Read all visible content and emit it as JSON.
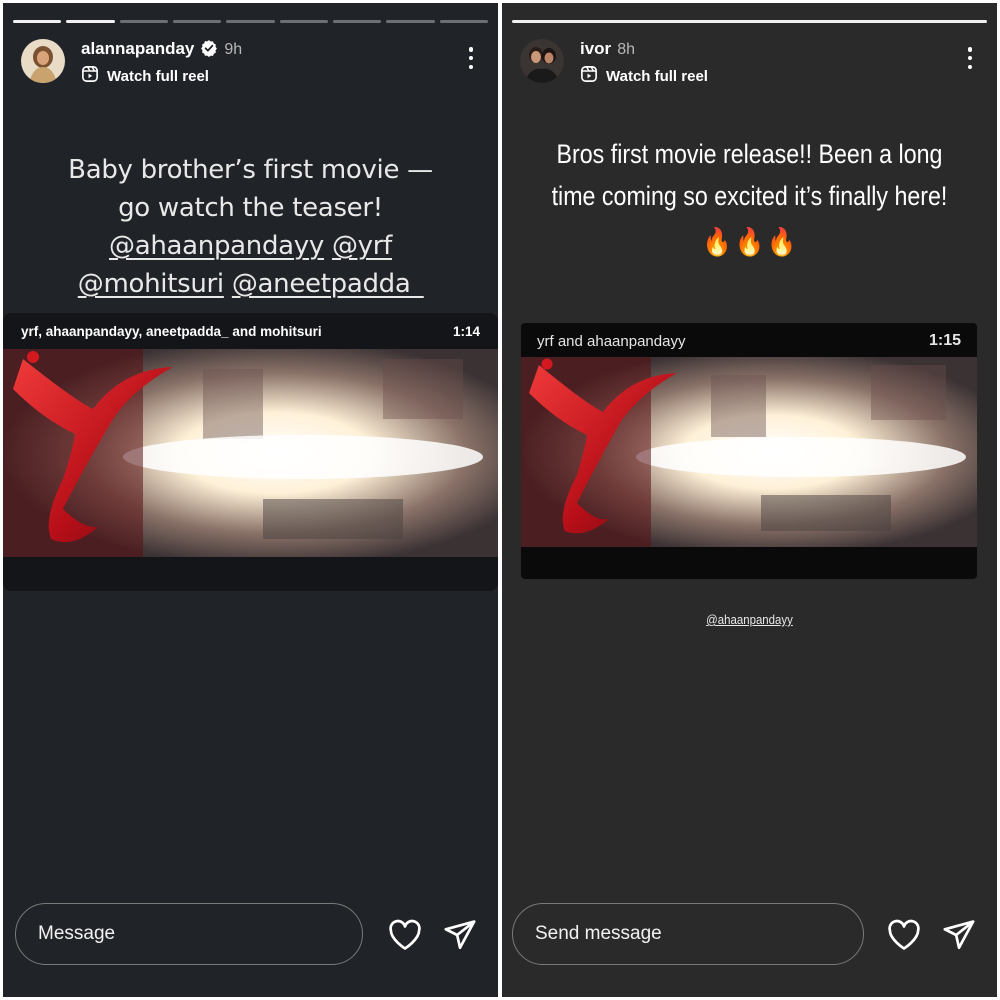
{
  "left_story": {
    "username": "alannapanday",
    "time": "9h",
    "watch_full_reel": "Watch full reel",
    "caption": {
      "line1": "Baby brother’s first movie —",
      "line2": "go watch the teaser!",
      "mentions_line3": [
        "@ahaanpandayy",
        "@yrf"
      ],
      "mentions_line4": [
        "@mohitsuri",
        "@aneetpadda_"
      ]
    },
    "video": {
      "authors": "yrf, ahaanpandayy, aneetpadda_ and mohitsuri",
      "duration": "1:14"
    },
    "message_placeholder": "Message",
    "progress_segments": 9,
    "active_segments": 2
  },
  "right_story": {
    "username": "ivor",
    "time": "8h",
    "watch_full_reel": "Watch full reel",
    "caption": {
      "line1": "Bros first movie release!! Been a long",
      "line2": "time coming so excited it’s finally here!",
      "emoji": [
        "🔥",
        "🔥",
        "🔥"
      ]
    },
    "video": {
      "authors": "yrf and ahaanpandayy",
      "duration": "1:15"
    },
    "mention": "@ahaanpandayy",
    "message_placeholder": "Send message",
    "progress_segments": 1,
    "active_segments": 1
  },
  "colors": {
    "left_bg": "#202327",
    "right_bg": "#2a2a2a",
    "verified_badge": "#ffffff",
    "yrf_red": "#c0141c"
  },
  "icons": [
    "verified-badge-icon",
    "reel-icon",
    "more-options-icon",
    "heart-icon",
    "send-icon",
    "fire-emoji"
  ]
}
